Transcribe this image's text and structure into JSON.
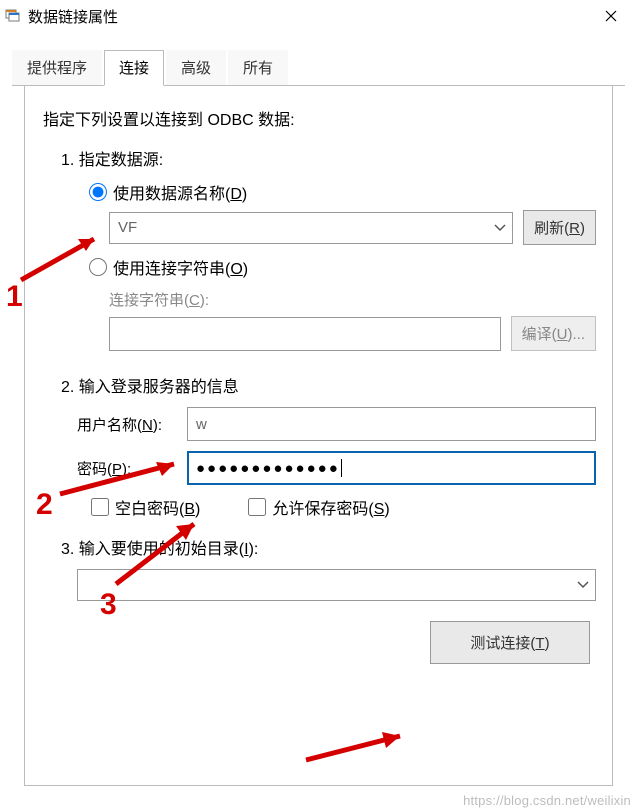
{
  "window": {
    "title": "数据链接属性"
  },
  "tabs": {
    "provider": "提供程序",
    "connection": "连接",
    "advanced": "高级",
    "all": "所有"
  },
  "content": {
    "heading": "指定下列设置以连接到 ODBC 数据:",
    "section1": "1. 指定数据源:",
    "opt_use_dsn": "使用数据源名称(D)",
    "dsn_value": "VF",
    "refresh_btn": "刷新(R)",
    "opt_use_connstr": "使用连接字符串(O)",
    "connstr_label": "连接字符串(C):",
    "build_btn": "编译(U)...",
    "connstr_value": "",
    "section2": "2. 输入登录服务器的信息",
    "user_label": "用户名称(N):",
    "user_value": "w",
    "pwd_label": "密码(P):",
    "pwd_value": "●●●●●●●●●●●●●",
    "blank_pwd": "空白密码(B)",
    "allow_save": "允许保存密码(S)",
    "section3": "3. 输入要使用的初始目录(I):",
    "catalog_value": "",
    "test_btn": "测试连接(T)"
  },
  "annotations": {
    "n1": "1",
    "n2": "2",
    "n3": "3"
  },
  "watermark": "https://blog.csdn.net/weilixin"
}
